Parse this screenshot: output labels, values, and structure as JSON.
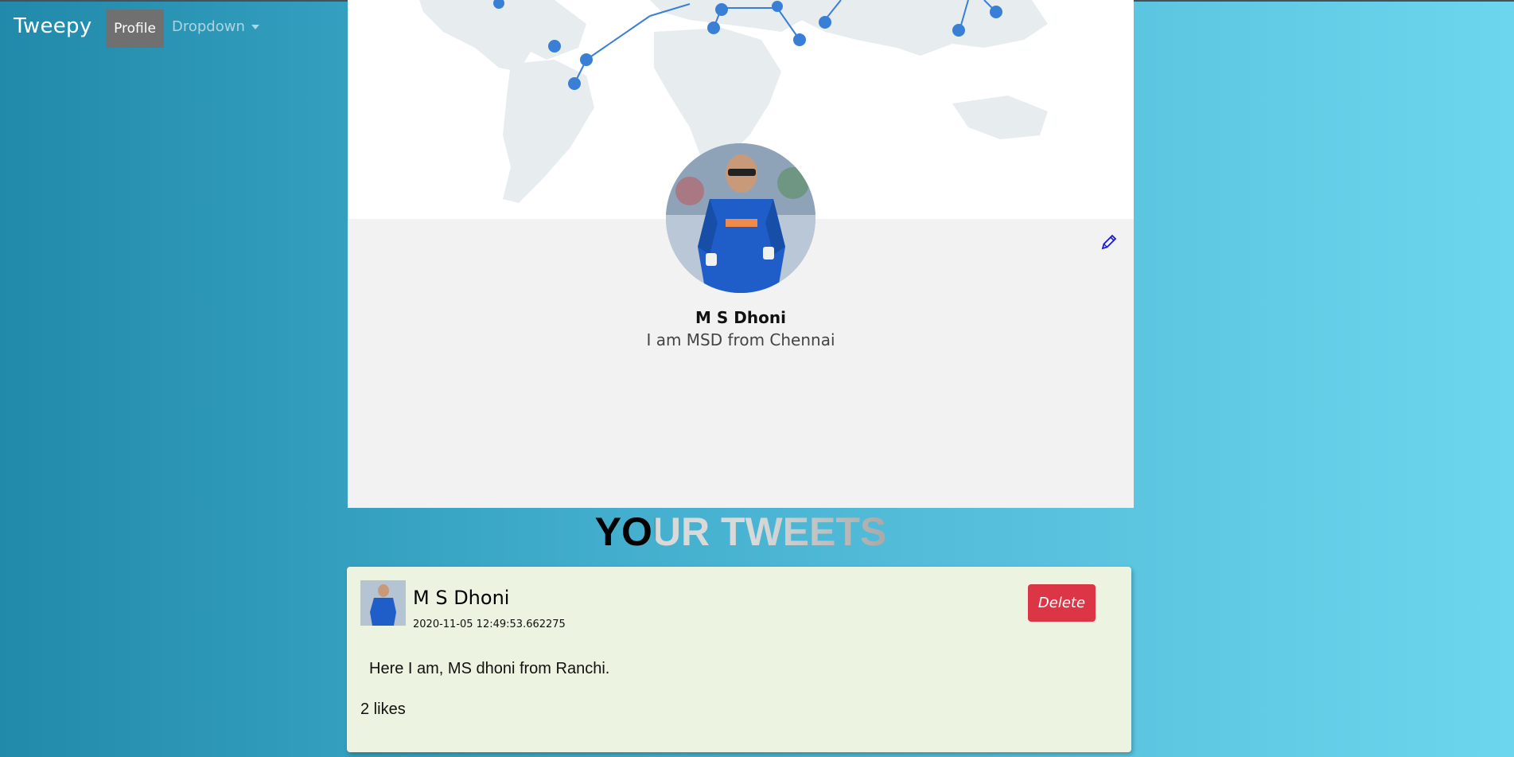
{
  "navbar": {
    "brand": "Tweepy",
    "items": [
      {
        "label": "Profile",
        "active": true
      },
      {
        "label": "Dropdown",
        "has_caret": true
      }
    ]
  },
  "profile": {
    "name": "M S Dhoni",
    "bio": "I am MSD from Chennai",
    "edit_icon": "pencil-icon"
  },
  "section_heading": {
    "text": "YOUR TWEETS"
  },
  "tweets": [
    {
      "author": "M S Dhoni",
      "timestamp": "2020-11-05 12:49:53.662275",
      "text": "Here I am, MS dhoni from Ranchi.",
      "likes": "2 likes",
      "delete_label": "Delete"
    }
  ],
  "colors": {
    "background_start": "#2189a9",
    "background_end": "#6cd6ee",
    "delete_button": "#dc3545",
    "tweet_card": "#ecf3e0",
    "card_body": "#f2f2f2",
    "profile_nav_active": "#707070",
    "pin_blue": "#3a7fd6"
  }
}
